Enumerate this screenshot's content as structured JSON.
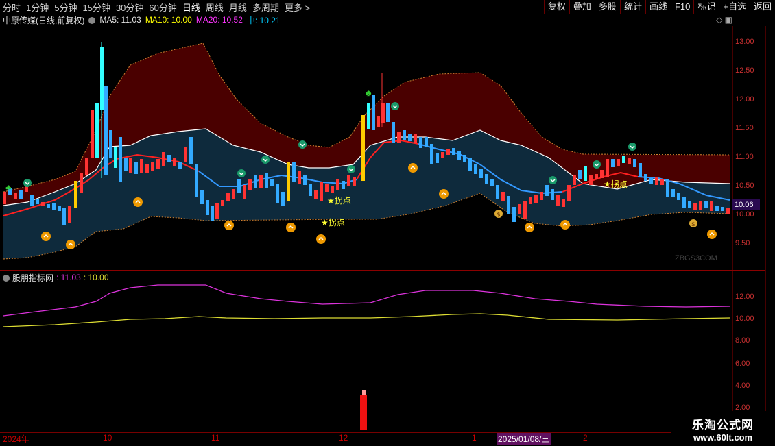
{
  "toolbar": {
    "periods": [
      "分时",
      "1分钟",
      "5分钟",
      "15分钟",
      "30分钟",
      "60分钟",
      "日线",
      "周线",
      "月线",
      "多周期",
      "更多 >"
    ],
    "active_period": "日线",
    "actions": [
      "复权",
      "叠加",
      "多股",
      "统计",
      "画线",
      "F10",
      "标记",
      "+自选",
      "返回"
    ]
  },
  "header": {
    "stock_name": "中原传媒(日线,前复权)",
    "ma5": "MA5: 11.03",
    "ma10": "MA10: 10.00",
    "ma20": "MA20: 10.52",
    "mid": "中: 10.21"
  },
  "price_axis": [
    "13.00",
    "12.50",
    "12.00",
    "11.50",
    "11.00",
    "10.50",
    "10.00",
    "9.50"
  ],
  "current_price": "10.06",
  "annotations": {
    "turn_point": "★拐点"
  },
  "sub_panel": {
    "title": "股朋指标网",
    "v1": ": 11.03",
    "v2": ": 10.00",
    "axis": [
      "12.00",
      "10.00",
      "8.00",
      "6.00",
      "4.00",
      "2.00"
    ]
  },
  "x_axis": {
    "labels": [
      "2024年",
      "10",
      "11",
      "12",
      "1",
      "2"
    ],
    "cursor_date": "2025/01/08/三"
  },
  "watermark": {
    "name": "乐淘公式网",
    "url": "www.60lt.com",
    "small": "ZBGS3COM"
  },
  "colors": {
    "up": "#ff3333",
    "down": "#33aaff",
    "ma5": "#ffffff",
    "ma10": "#ffff00",
    "ma20": "#ff33ff",
    "mid": "#00ccff"
  }
}
